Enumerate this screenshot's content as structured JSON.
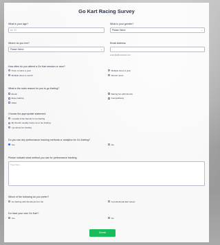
{
  "form": {
    "title": "Go Kart Racing Survey",
    "age": {
      "label": "What is your age?",
      "placeholder": "ex: 23"
    },
    "gender": {
      "label": "What is your gender?",
      "value": "Please Select"
    },
    "location": {
      "label": "Where do you live?",
      "value": "Please Select"
    },
    "email": {
      "label": "Email Address",
      "sublabel": "example@example.com"
    },
    "frequency": {
      "label": "How often do you attend a Go Kart session or race?",
      "options": [
        "Once or twice a year",
        "Multiple times a year",
        "Multiple times a month",
        "Almost never"
      ]
    },
    "reasons": {
      "label": "What is the main reason for you to go Karting?",
      "options": [
        "Exotic",
        "Racing fun with friends",
        "Enjoy karting",
        "Competitively",
        "Other"
      ]
    },
    "statement": {
      "label": "Choose the appropriate statement.",
      "options": [
        "I usually invite friends to Go Karting",
        "My friends usually invite me to Go Karting",
        "I go alone Go Karting"
      ]
    },
    "performance": {
      "label": "Do you use any performance tracking methods or analytics for Go Karting?",
      "options": [
        "Yes",
        "No"
      ]
    },
    "method": {
      "label": "Please indicate what method you use for performance tracking.",
      "placeholder": "Type here..."
    },
    "prefer": {
      "label": "Which of the following do you prefer?",
      "options": [
        "Go Karting with friends just for fun",
        "A professional kart career"
      ]
    },
    "own": {
      "label": "Do have your own Go Kart?",
      "options": [
        "Yes",
        "No"
      ]
    },
    "submit_label": "Submit"
  },
  "colors": {
    "accent": "#2e69ff",
    "submit": "#18bd5b",
    "text": "#2c3345"
  }
}
